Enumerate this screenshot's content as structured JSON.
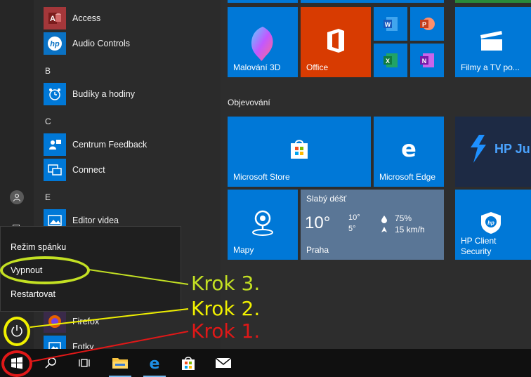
{
  "app_list": {
    "items": [
      {
        "label": "Access",
        "icon": "access-icon",
        "color": "#a4373a"
      },
      {
        "label": "Audio Controls",
        "icon": "hp-logo-icon",
        "color": "#0a72c4"
      },
      {
        "label": "Budíky a hodiny",
        "icon": "alarm-clock-icon",
        "color": "#0078d7"
      },
      {
        "label": "Centrum Feedback",
        "icon": "feedback-icon",
        "color": "#0078d7"
      },
      {
        "label": "Connect",
        "icon": "connect-icon",
        "color": "#0078d7"
      },
      {
        "label": "Editor videa",
        "icon": "video-editor-icon",
        "color": "#0078d7"
      },
      {
        "label": "Firefox",
        "icon": "firefox-icon",
        "color": "#e66000"
      },
      {
        "label": "Fotky",
        "icon": "photos-icon",
        "color": "#0078d7"
      }
    ],
    "letters": [
      "B",
      "C",
      "E"
    ]
  },
  "tiles": {
    "malovani": {
      "label": "Malování 3D"
    },
    "office": {
      "label": "Office"
    },
    "filmy": {
      "label": "Filmy a TV po..."
    },
    "group_title": "Objevování",
    "store": {
      "label": "Microsoft Store"
    },
    "edge": {
      "label": "Microsoft Edge"
    },
    "hp_ju": {
      "label": "HP Ju"
    },
    "mapy": {
      "label": "Mapy"
    },
    "weather": {
      "condition": "Slabý déšť",
      "temp": "10°",
      "high": "10°",
      "low": "5°",
      "humidity": "75%",
      "wind": "15 km/h",
      "city": "Praha"
    },
    "hp_security": {
      "label_line1": "HP Client",
      "label_line2": "Security"
    }
  },
  "power_menu": {
    "sleep": "Režim spánku",
    "shutdown": "Vypnout",
    "restart": "Restartovat"
  },
  "annotations": {
    "step1": "Krok 1.",
    "step2": "Krok 2.",
    "step3": "Krok 3."
  },
  "colors": {
    "accent": "#0078d7",
    "office": "#d83b01",
    "step1": "#e01818",
    "step2": "#f0f000",
    "step3": "#c3e023"
  }
}
